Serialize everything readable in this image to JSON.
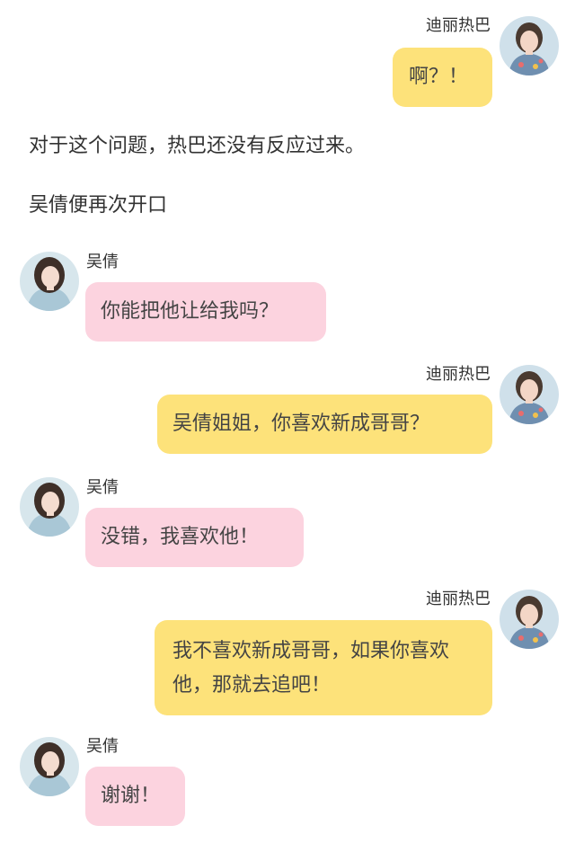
{
  "participants": {
    "dilireba": {
      "name": "迪丽热巴",
      "avatar_icon": "woman-portrait-avatar",
      "bubble_color": "#fde27a"
    },
    "wuqian": {
      "name": "吴倩",
      "avatar_icon": "woman-portrait-avatar",
      "bubble_color": "#fcd3df"
    }
  },
  "messages": [
    {
      "sender": "迪丽热巴",
      "text": "啊？！"
    },
    {
      "sender": "吴倩",
      "text": "你能把他让给我吗？"
    },
    {
      "sender": "迪丽热巴",
      "text": "吴倩姐姐，你喜欢新成哥哥？"
    },
    {
      "sender": "吴倩",
      "text": "没错，我喜欢他！"
    },
    {
      "sender": "迪丽热巴",
      "text": "我不喜欢新成哥哥，如果你喜欢他，那就去追吧！"
    },
    {
      "sender": "吴倩",
      "text": "谢谢！"
    }
  ],
  "narration": [
    "对于这个问题，热巴还没有反应过来。",
    "吴倩便再次开口"
  ]
}
